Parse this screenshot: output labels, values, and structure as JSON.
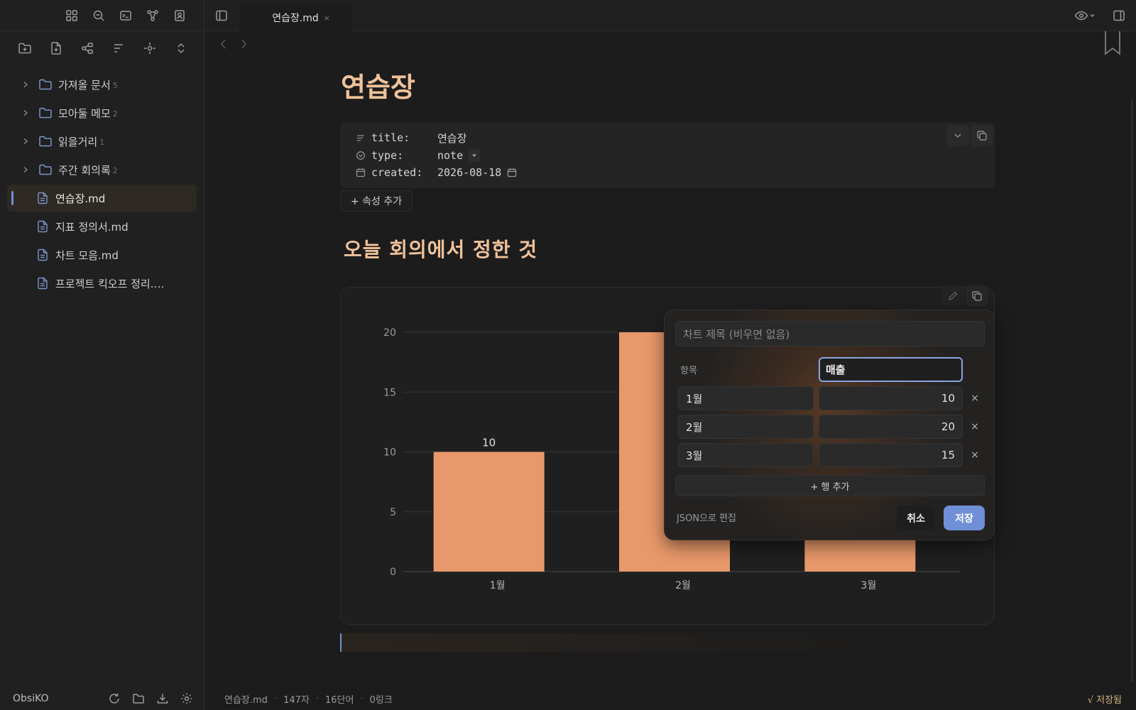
{
  "app": {
    "vault_name": "ObsiKO",
    "tab_title": "연습장.md",
    "tab_close": "×"
  },
  "sidebar": {
    "tree": [
      {
        "type": "folder",
        "label": "가져올 문서",
        "count": "5"
      },
      {
        "type": "folder",
        "label": "모아둘 메모",
        "count": "2"
      },
      {
        "type": "folder",
        "label": "읽을거리",
        "count": "1"
      },
      {
        "type": "folder",
        "label": "주간 회의록",
        "count": "2"
      },
      {
        "type": "file",
        "label": "연습장.md",
        "active": true
      },
      {
        "type": "file",
        "label": "지표 정의서.md"
      },
      {
        "type": "file",
        "label": "차트 모음.md"
      },
      {
        "type": "file",
        "label": "프로젝트 킥오프 정리.…"
      }
    ]
  },
  "document": {
    "title": "연습장",
    "properties": [
      {
        "icon": "text-lines-icon",
        "key": "title:",
        "value": "연습장"
      },
      {
        "icon": "circle-chevron-icon",
        "key": "type:",
        "value": "note"
      },
      {
        "icon": "calendar-icon",
        "key": "created:",
        "value": "2026-08-18"
      }
    ],
    "add_property_label": "+ 속성 추가",
    "heading": "오늘 회의에서 정한 것"
  },
  "chart_data": {
    "type": "bar",
    "categories": [
      "1월",
      "2월",
      "3월"
    ],
    "series": [
      {
        "name": "매출",
        "values": [
          10,
          20,
          15
        ]
      }
    ],
    "title": "",
    "xlabel": "",
    "ylabel": "",
    "ylim": [
      0,
      20
    ],
    "yticks": [
      0,
      5,
      10,
      15,
      20
    ],
    "data_labels_shown": [
      "10"
    ],
    "grid": "horizontal",
    "bar_color": "#e8986a"
  },
  "chart_editor": {
    "title_placeholder": "차트 제목 (비우면 없음)",
    "category_header": "항목",
    "series_header": "매출",
    "rows": [
      {
        "category": "1월",
        "value": "10"
      },
      {
        "category": "2월",
        "value": "20"
      },
      {
        "category": "3월",
        "value": "15"
      }
    ],
    "remove_glyph": "×",
    "add_row_label": "+ 행 추가",
    "json_edit_label": "JSON으로 편집",
    "cancel_label": "취소",
    "save_label": "저장"
  },
  "statusbar": {
    "file": "연습장.md",
    "chars": "147자",
    "words": "16단어",
    "links": "0링크",
    "saved": "√ 저장됨"
  },
  "colors": {
    "accent": "#6f8fd6",
    "heading": "#f0c29a",
    "bar": "#e8986a",
    "saved": "#d3b27c"
  }
}
